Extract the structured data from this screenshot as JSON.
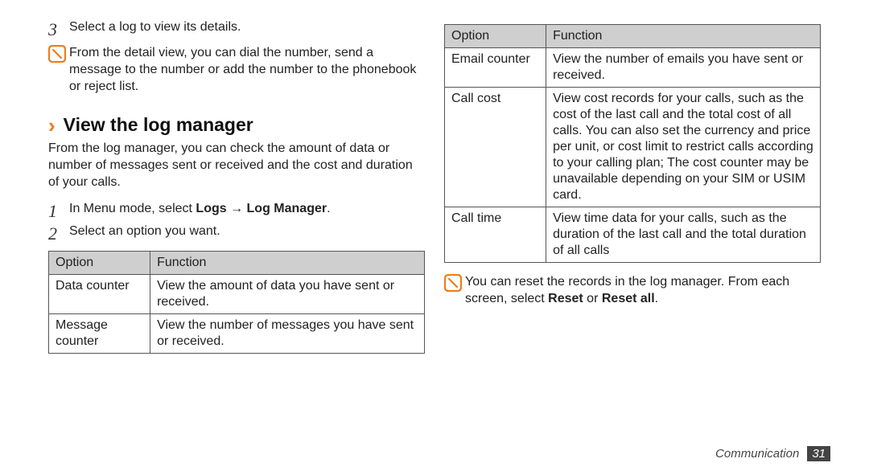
{
  "left": {
    "step3_num": "3",
    "step3_text": "Select a log to view its details.",
    "note1": "From the detail view, you can dial the number, send a message to the number or add the number to the phonebook or reject list.",
    "section_title": "View the log manager",
    "intro": "From the log manager, you can check the amount of data or number of messages sent or received and the cost and duration of your calls.",
    "step1_num": "1",
    "step1_pre": "In Menu mode, select ",
    "step1_bold": "Logs → Log Manager",
    "step1_post": ".",
    "step2_num": "2",
    "step2_text": "Select an option you want.",
    "th_option": "Option",
    "th_function": "Function",
    "rows": [
      {
        "option": "Data counter",
        "fn": "View the amount of data you have sent or received."
      },
      {
        "option": "Message counter",
        "fn": "View the number of messages you have sent or received."
      }
    ]
  },
  "right": {
    "th_option": "Option",
    "th_function": "Function",
    "rows": [
      {
        "option": "Email counter",
        "fn": "View the number of emails you have sent or received."
      },
      {
        "option": "Call cost",
        "fn": "View cost records for your calls, such as the cost of the last call and the total cost of all calls. You can also set the currency and price per unit, or cost limit to restrict calls according to your calling plan; The cost counter may be unavailable depending on your SIM or USIM card."
      },
      {
        "option": "Call time",
        "fn": "View time data for your calls, such as the duration of the last call and the total duration of all calls"
      }
    ],
    "note2_pre": "You can reset the records in the log manager. From each screen, select ",
    "note2_b1": "Reset",
    "note2_mid": " or ",
    "note2_b2": "Reset all",
    "note2_post": "."
  },
  "footer": {
    "section": "Communication",
    "page": "31"
  }
}
